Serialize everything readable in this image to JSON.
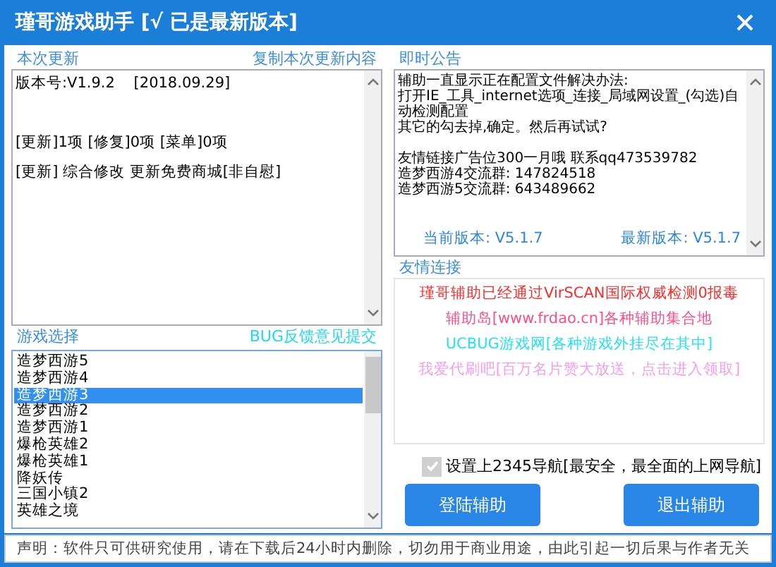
{
  "window": {
    "title": "瑾哥游戏助手 [√ 已是最新版本]"
  },
  "update": {
    "heading": "本次更新",
    "copy_link": "复制本次更新内容",
    "lines": [
      "版本号:V1.9.2    [2018.09.29]",
      "[更新]1项 [修复]0项 [菜单]0项",
      "[更新] 综合修改 更新免费商城[非自慰]"
    ]
  },
  "notice": {
    "heading": "即时公告",
    "paragraphs": [
      [
        "辅助一直显示正在配置文件解决办法:",
        "打开IE_工具_internet选项_连接_局域网设置_(勾选)自动检测配置",
        "其它的勾去掉,确定。然后再试试?"
      ],
      [
        "友情链接广告位300一月哦 联系qq473539782",
        "造梦西游4交流群: 147824518",
        "造梦西游5交流群: 643489662"
      ]
    ],
    "current_version": "当前版本: V5.1.7",
    "latest_version": "最新版本: V5.1.7"
  },
  "games": {
    "heading": "游戏选择",
    "feedback_link": "BUG反馈意见提交",
    "items": [
      {
        "label": "造梦西游5",
        "selected": false
      },
      {
        "label": "造梦西游4",
        "selected": false
      },
      {
        "label": "造梦西游3",
        "selected": true
      },
      {
        "label": "造梦西游2",
        "selected": false
      },
      {
        "label": "造梦西游1",
        "selected": false
      },
      {
        "label": "爆枪英雄2",
        "selected": false
      },
      {
        "label": "爆枪英雄1",
        "selected": false
      },
      {
        "label": "降妖传",
        "selected": false
      },
      {
        "label": "三国小镇2",
        "selected": false
      },
      {
        "label": "英雄之境",
        "selected": false
      }
    ]
  },
  "links": {
    "heading": "友情连接",
    "items": [
      {
        "label": "瑾哥辅助已经通过VirSCAN国际权威检测0报毒",
        "color": "#ff2a2a"
      },
      {
        "label": "辅助岛[www.frdao.cn]各种辅助集合地",
        "color": "#ff4d88"
      },
      {
        "label": "UCBUG游戏网[各种游戏外挂尽在其中]",
        "color": "#22e4f0"
      },
      {
        "label": "我爱代刷吧[百万名片赞大放送，点击进入领取]",
        "color": "#f79cf2"
      }
    ]
  },
  "nav_option": {
    "label": "设置上2345导航[最安全，最全面的上网导航]",
    "checked": true,
    "disabled": true
  },
  "buttons": [
    "登陆辅助",
    "退出辅助"
  ],
  "status_bar": "声明：软件只可供研究使用，请在下载后24小时内删除，切勿用于商业用途，由此引起一切后果与作者无关"
}
